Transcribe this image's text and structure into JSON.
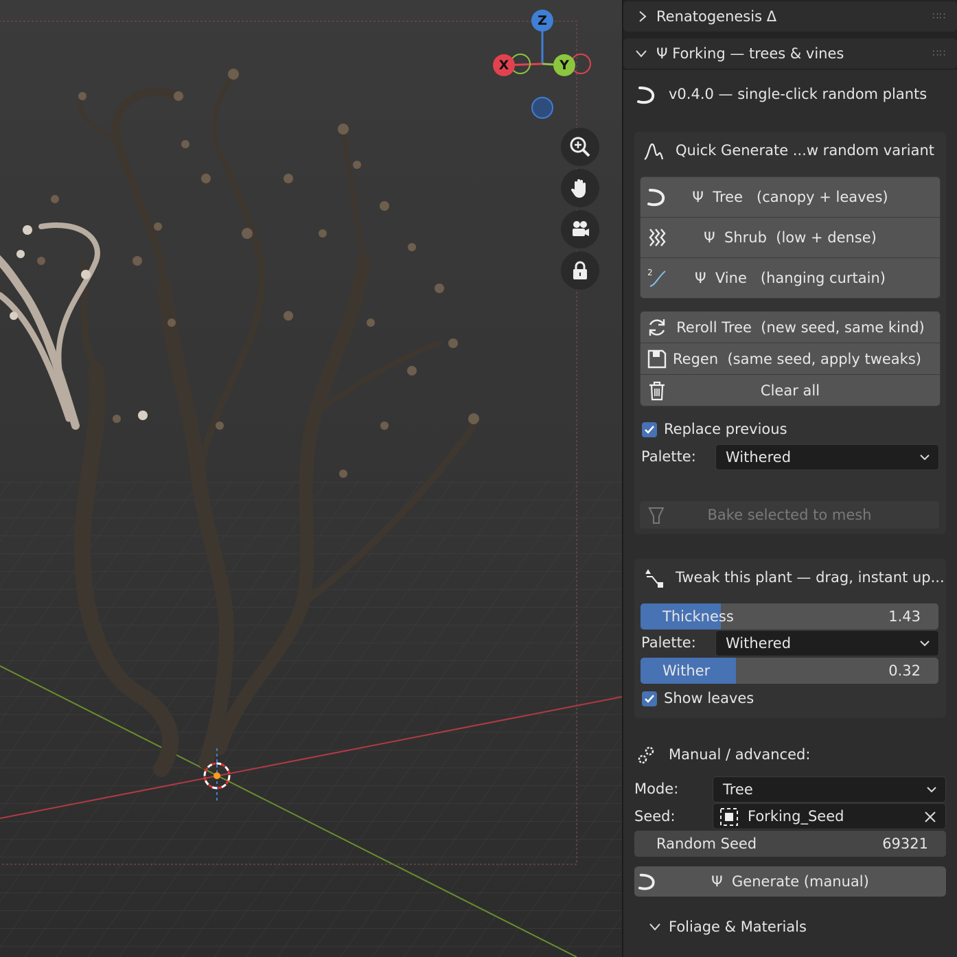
{
  "viewport": {
    "gizmo": {
      "z": "Z",
      "x": "X",
      "y": "Y"
    },
    "nav_icons": [
      "zoom-icon",
      "hand-pan-icon",
      "camera-icon",
      "lock-icon"
    ]
  },
  "sidebar": {
    "panel_collapsed": {
      "title": "Renatogenesis Δ"
    },
    "panel_main": {
      "title": "Ψ  Forking — trees & vines",
      "version": "v0.4.0 — single-click random plants",
      "quick": {
        "header": "Quick Generate ...w random variant",
        "buttons": [
          {
            "label": "Ψ  Tree   (canopy + leaves)",
            "icon": "hook-icon"
          },
          {
            "label": "Ψ  Shrub  (low + dense)",
            "icon": "shrub-waves-icon"
          },
          {
            "label": "Ψ  Vine   (hanging curtain)",
            "icon": "vine-curve-icon"
          }
        ],
        "actions": [
          {
            "label": "Reroll Tree  (new seed, same kind)",
            "icon": "reroll-icon"
          },
          {
            "label": "Regen  (same seed, apply tweaks)",
            "icon": "save-icon"
          },
          {
            "label": "Clear all",
            "icon": "trash-icon"
          }
        ],
        "replace_previous": "Replace previous",
        "palette_label": "Palette:",
        "palette_value": "Withered",
        "bake_label": "Bake selected to mesh"
      },
      "tweak": {
        "header": "Tweak this plant — drag, instant up...",
        "thickness": {
          "label": "Thickness",
          "value": "1.43",
          "fraction": 0.27
        },
        "palette_label": "Palette:",
        "palette_value": "Withered",
        "wither": {
          "label": "Wither",
          "value": "0.32",
          "fraction": 0.32
        },
        "show_leaves": "Show leaves"
      },
      "manual": {
        "header": "Manual / advanced:",
        "mode_label": "Mode:",
        "mode_value": "Tree",
        "seed_label": "Seed:",
        "seed_value": "Forking_Seed",
        "random_seed_label": "Random Seed",
        "random_seed_value": "69321",
        "generate_label": "Ψ  Generate (manual)"
      },
      "foliage": {
        "title": "Foliage & Materials"
      }
    }
  },
  "colors": {
    "accent": "#4772b3",
    "x_axis": "#e2424f",
    "y_axis": "#8cc63f",
    "z_axis": "#3f7fd6"
  }
}
